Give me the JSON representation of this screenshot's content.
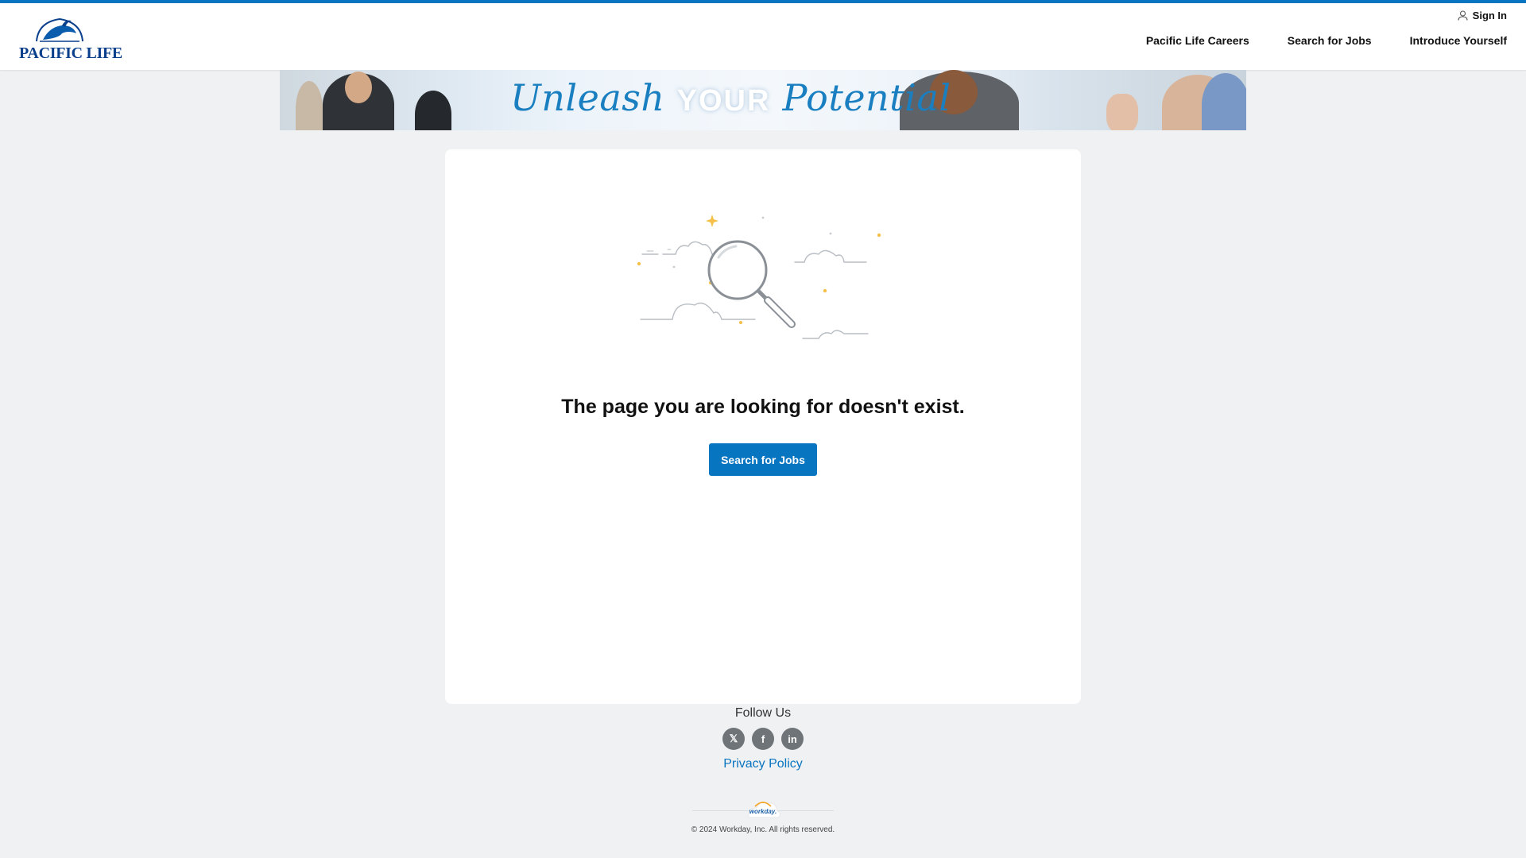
{
  "header": {
    "logo_text": "PACIFIC LIFE",
    "sign_in": "Sign In",
    "nav": [
      "Pacific Life Careers",
      "Search for Jobs",
      "Introduce Yourself"
    ]
  },
  "banner": {
    "word_1": "Unleash",
    "word_2": "YOUR",
    "word_3": "Potential"
  },
  "main": {
    "message": "The page you are looking for doesn't exist.",
    "search_button": "Search for Jobs"
  },
  "footer": {
    "follow_us": "Follow Us",
    "social": [
      {
        "icon": "x-twitter-icon",
        "glyph": "𝕏"
      },
      {
        "icon": "facebook-icon",
        "glyph": "f"
      },
      {
        "icon": "linkedin-icon",
        "glyph": "in"
      }
    ],
    "privacy_policy": "Privacy Policy",
    "workday_logo": "workday.",
    "copyright": "© 2024 Workday, Inc. All rights reserved."
  },
  "colors": {
    "accent": "#0875c1",
    "background": "#f0f1f2",
    "social_icon_bg": "#6f7478"
  }
}
